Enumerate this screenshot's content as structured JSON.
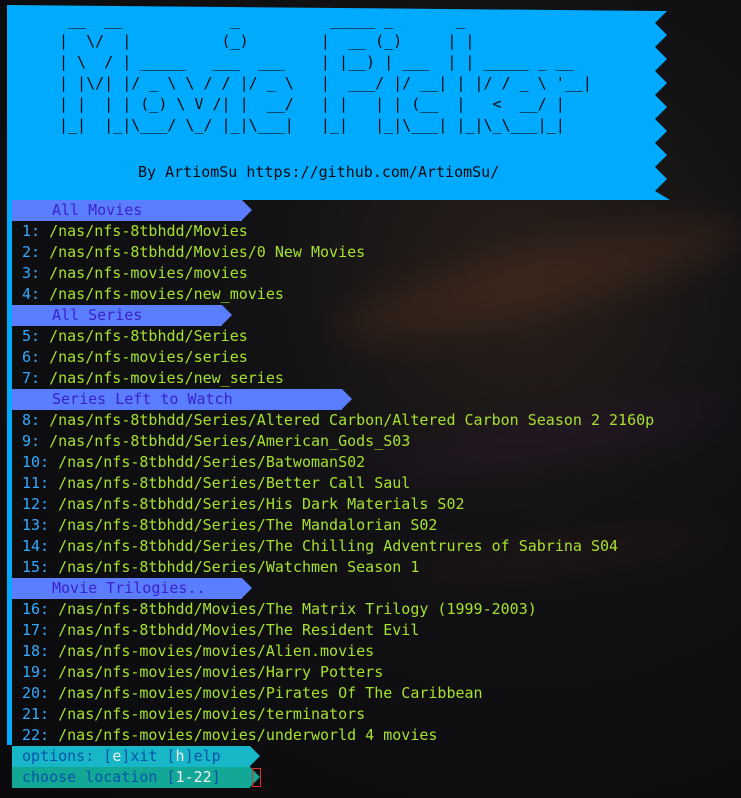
{
  "banner": {
    "ascii_art": " __  __            _          _____ _       _\n|  \\/  |          (_)        |  __ (_)     | |\n| \\  / | _____   ___  ___    | |__) | ___  | | _____ _ __\n| |\\/| |/ _ \\ \\ / / |/ _ \\   |  ___/ |/ __| | |/ / _ \\ '__|\n| |  | | (_) \\ V /| |  __/   | |   | | (__  |   <  __/ |\n|_|  |_|\\___/ \\_/ |_|\\___|   |_|   |_|\\___| |_|\\_\\___|_|",
    "byline": "By ArtiomSu https://github.com/ArtiomSu/"
  },
  "sections": [
    {
      "title": "All Movies",
      "items": [
        {
          "num": "1:",
          "path": "/nas/nfs-8tbhdd/Movies"
        },
        {
          "num": "2:",
          "path": "/nas/nfs-8tbhdd/Movies/0 New Movies"
        },
        {
          "num": "3:",
          "path": "/nas/nfs-movies/movies"
        },
        {
          "num": "4:",
          "path": "/nas/nfs-movies/new_movies"
        }
      ]
    },
    {
      "title": "All Series",
      "items": [
        {
          "num": "5:",
          "path": "/nas/nfs-8tbhdd/Series"
        },
        {
          "num": "6:",
          "path": "/nas/nfs-movies/series"
        },
        {
          "num": "7:",
          "path": "/nas/nfs-movies/new_series"
        }
      ]
    },
    {
      "title": "Series Left to Watch",
      "items": [
        {
          "num": "8:",
          "path": "/nas/nfs-8tbhdd/Series/Altered Carbon/Altered Carbon Season 2 2160p"
        },
        {
          "num": "9:",
          "path": "/nas/nfs-8tbhdd/Series/American_Gods_S03"
        },
        {
          "num": "10:",
          "path": "/nas/nfs-8tbhdd/Series/BatwomanS02"
        },
        {
          "num": "11:",
          "path": "/nas/nfs-8tbhdd/Series/Better Call Saul"
        },
        {
          "num": "12:",
          "path": "/nas/nfs-8tbhdd/Series/His Dark Materials S02"
        },
        {
          "num": "13:",
          "path": "/nas/nfs-8tbhdd/Series/The Mandalorian S02"
        },
        {
          "num": "14:",
          "path": "/nas/nfs-8tbhdd/Series/The Chilling Adventrures of Sabrina S04"
        },
        {
          "num": "15:",
          "path": "/nas/nfs-8tbhdd/Series/Watchmen Season 1"
        }
      ]
    },
    {
      "title": "Movie Trilogies..",
      "items": [
        {
          "num": "16:",
          "path": "/nas/nfs-8tbhdd/Movies/The Matrix Trilogy (1999-2003)"
        },
        {
          "num": "17:",
          "path": "/nas/nfs-8tbhdd/Movies/The Resident Evil"
        },
        {
          "num": "18:",
          "path": "/nas/nfs-movies/movies/Alien.movies"
        },
        {
          "num": "19:",
          "path": "/nas/nfs-movies/movies/Harry Potters"
        },
        {
          "num": "20:",
          "path": "/nas/nfs-movies/movies/Pirates Of The Caribbean"
        },
        {
          "num": "21:",
          "path": "/nas/nfs-movies/movies/terminators"
        },
        {
          "num": "22:",
          "path": "/nas/nfs-movies/movies/underworld 4 movies"
        }
      ]
    }
  ],
  "footer": {
    "options_prefix": "options: [",
    "exit_key": "e",
    "exit_rest": "]xit [",
    "help_key": "h",
    "help_rest": "]elp",
    "prompt_prefix": "choose location [",
    "prompt_range": "1-22",
    "prompt_suffix": "]"
  },
  "colors": {
    "banner_bg": "#00aaff",
    "section_header_bg": "#5b7dff",
    "item_number": "#33aaff",
    "item_path": "#a6e22e",
    "footer_options_bg": "#18b7c8",
    "footer_prompt_bg": "#13a896",
    "cursor_border": "#e03030"
  }
}
